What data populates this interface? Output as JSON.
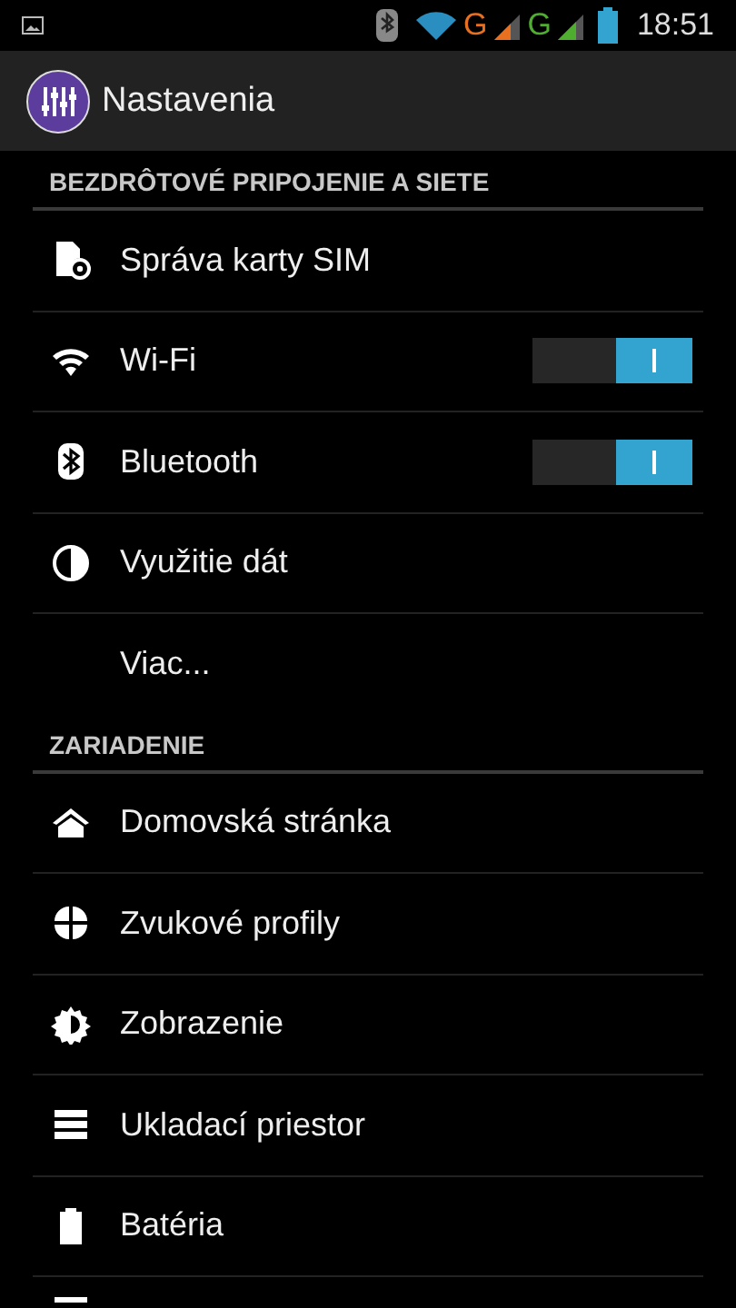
{
  "status_bar": {
    "networks": [
      {
        "label": "G",
        "color": "#e8701f"
      },
      {
        "label": "G",
        "color": "#4fae2f"
      }
    ],
    "time": "18:51"
  },
  "action_bar": {
    "title": "Nastavenia"
  },
  "sections": [
    {
      "title": "BEZDRÔTOVÉ PRIPOJENIE A SIETE",
      "items": [
        {
          "label": "Správa karty SIM",
          "kind": "plain"
        },
        {
          "label": "Wi-Fi",
          "kind": "toggle",
          "on": true
        },
        {
          "label": "Bluetooth",
          "kind": "toggle",
          "on": true
        },
        {
          "label": "Využitie dát",
          "kind": "plain"
        },
        {
          "label": "Viac...",
          "kind": "plain"
        }
      ]
    },
    {
      "title": "ZARIADENIE",
      "items": [
        {
          "label": "Domovská stránka",
          "kind": "plain"
        },
        {
          "label": "Zvukové profily",
          "kind": "plain"
        },
        {
          "label": "Zobrazenie",
          "kind": "plain"
        },
        {
          "label": "Ukladací priestor",
          "kind": "plain"
        },
        {
          "label": "Batéria",
          "kind": "plain"
        },
        {
          "kind": "cut"
        }
      ]
    }
  ]
}
